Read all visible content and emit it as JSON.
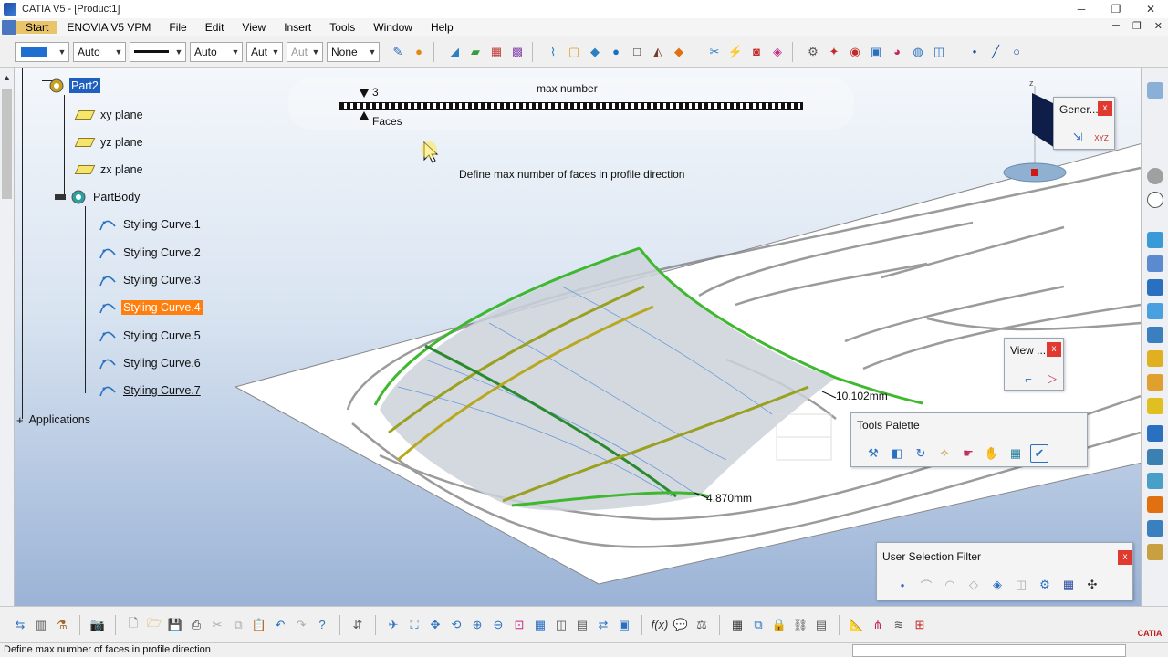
{
  "window": {
    "title": "CATIA V5 - [Product1]",
    "minimize": "─",
    "restore": "❐",
    "close": "✕"
  },
  "menu": {
    "items": [
      "Start",
      "ENOVIA V5 VPM",
      "File",
      "Edit",
      "View",
      "Insert",
      "Tools",
      "Window",
      "Help"
    ],
    "doc_min": "─",
    "doc_restore": "❐",
    "doc_close": "✕"
  },
  "properties_toolbar": {
    "color_combo": "",
    "transparency_combo": "Auto",
    "linetype_combo": "",
    "lineweight_combo": "Auto",
    "point_combo": "Aut",
    "layer_prefix_combo": "Aut",
    "layer_combo": "None"
  },
  "tree": {
    "root": "Part2",
    "planes": [
      "xy plane",
      "yz plane",
      "zx plane"
    ],
    "body": "PartBody",
    "curves": [
      "Styling Curve.1",
      "Styling Curve.2",
      "Styling Curve.3",
      "Styling Curve.4",
      "Styling Curve.5",
      "Styling Curve.6",
      "Styling Curve.7"
    ],
    "highlighted_curve_index": 3,
    "applications": "Applications"
  },
  "slider": {
    "value": "3",
    "title": "max number",
    "unit_label": "Faces",
    "hint": "Define max number of faces in profile direction",
    "level": 0.05
  },
  "dimensions": {
    "d1": "10.102mm",
    "d2": "4.870mm"
  },
  "palettes": {
    "general": "Gener...",
    "view": "View ...",
    "tools": "Tools Palette",
    "user_selection": "User Selection Filter",
    "close": "x"
  },
  "compass": {
    "z_label": "z",
    "xyz_label": "XYZ"
  },
  "status": {
    "text": "Define max number of faces in profile direction"
  },
  "logo": {
    "text": "CATIA"
  },
  "colors": {
    "accent_select": "#1f5fbf",
    "highlight": "#ff7f0e",
    "curve_green": "#3fb830",
    "curve_yellow": "#c8b820"
  }
}
